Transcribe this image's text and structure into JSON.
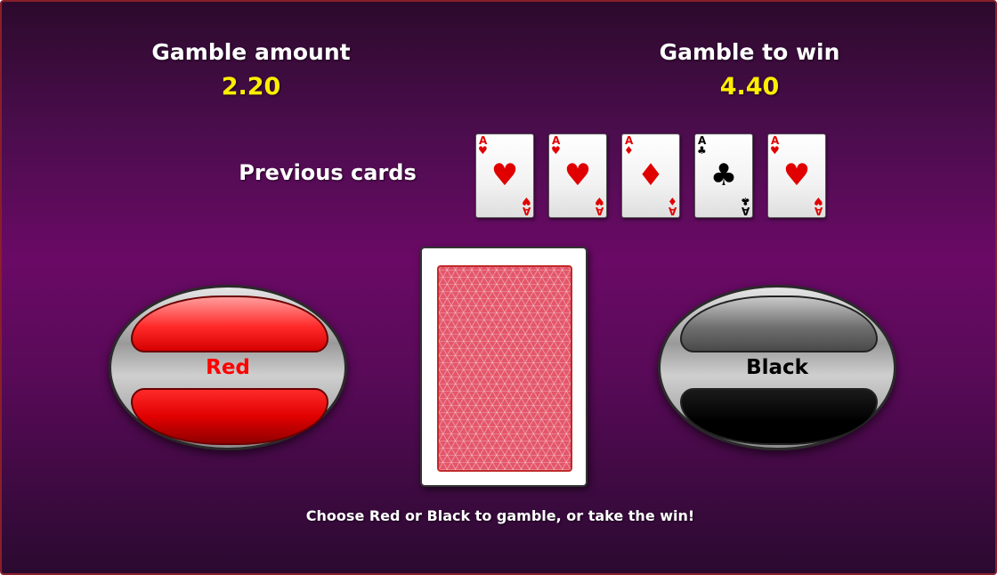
{
  "header": {
    "gamble_amount_label": "Gamble amount",
    "gamble_amount_value": "2.20",
    "gamble_to_win_label": "Gamble to win",
    "gamble_to_win_value": "4.40"
  },
  "previous_cards": {
    "label": "Previous cards",
    "cards": [
      {
        "rank": "A",
        "suit": "♥",
        "suit_name": "hearts",
        "color": "#e00000"
      },
      {
        "rank": "A",
        "suit": "♥",
        "suit_name": "hearts",
        "color": "#e00000"
      },
      {
        "rank": "A",
        "suit": "♦",
        "suit_name": "diamonds",
        "color": "#e00000"
      },
      {
        "rank": "A",
        "suit": "♣",
        "suit_name": "clubs",
        "color": "#000000"
      },
      {
        "rank": "A",
        "suit": "♥",
        "suit_name": "hearts",
        "color": "#e00000"
      }
    ]
  },
  "buttons": {
    "red_label": "Red",
    "black_label": "Black"
  },
  "hint": "Choose Red or Black to gamble, or take the win!",
  "colors": {
    "value_yellow": "#ffee00",
    "red_accent": "#ff0000",
    "card_back": "#e4566a"
  }
}
